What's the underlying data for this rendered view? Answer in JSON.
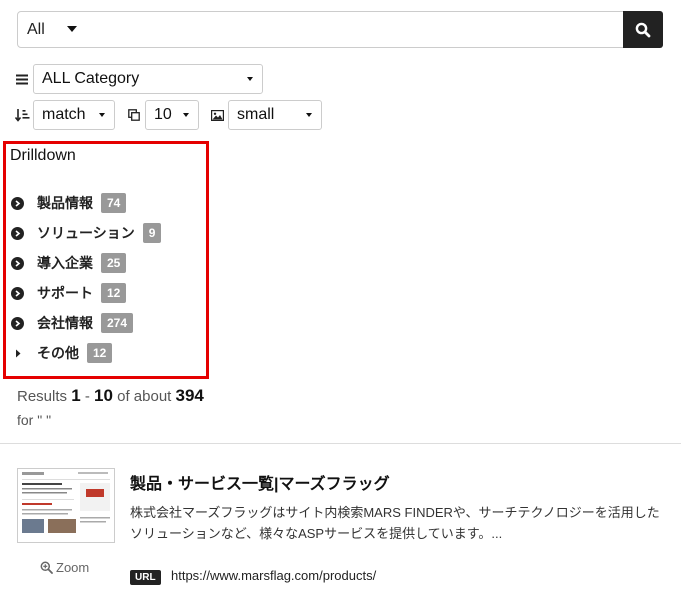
{
  "search": {
    "scope_value": "All",
    "query": "",
    "placeholder": ""
  },
  "filters": {
    "category": "ALL Category",
    "sort": "match",
    "per_page": "10",
    "thumb_size": "small"
  },
  "drilldown": {
    "title": "Drilldown",
    "items": [
      {
        "label": "製品情報",
        "count": "74",
        "icon": "circle-chevron-right-icon"
      },
      {
        "label": "ソリューション",
        "count": "9",
        "icon": "circle-chevron-right-icon"
      },
      {
        "label": "導入企業",
        "count": "25",
        "icon": "circle-chevron-right-icon"
      },
      {
        "label": "サポート",
        "count": "12",
        "icon": "circle-chevron-right-icon"
      },
      {
        "label": "会社情報",
        "count": "274",
        "icon": "circle-chevron-right-icon"
      },
      {
        "label": "その他",
        "count": "12",
        "icon": "caret-right-icon"
      }
    ]
  },
  "results_summary": {
    "prefix": "Results",
    "start": "1",
    "dash": "-",
    "end": "10",
    "of_about": "of about",
    "total": "394",
    "for_text": "for \" \""
  },
  "result": {
    "title": "製品・サービス一覧|マーズフラッグ",
    "description": "株式会社マーズフラッグはサイト内検索MARS FINDERや、サーチテクノロジーを活用したソリューションなど、様々なASPサービスを提供しています。...",
    "zoom_label": "Zoom",
    "url_badge": "URL",
    "url": "https://www.marsflag.com/products/"
  },
  "colors": {
    "accent_border": "#e50000",
    "badge_bg": "#999999",
    "search_button_bg": "#222222"
  }
}
